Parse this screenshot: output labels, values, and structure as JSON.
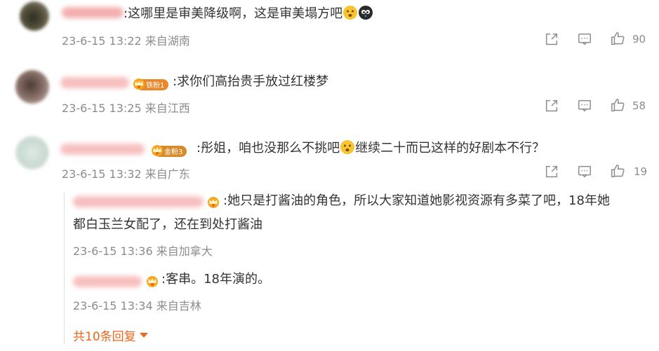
{
  "comments": [
    {
      "text": ":这哪里是审美降级啊，这是审美塌方吧",
      "time": "23-6-15 13:22",
      "location": "来自湖南",
      "likes": "90"
    },
    {
      "badge": "铁粉1",
      "text": ":求你们高抬贵手放过红楼梦",
      "time": "23-6-15 13:25",
      "location": "来自江西",
      "likes": "58"
    },
    {
      "badge": "金粉3",
      "text_a": ":彤姐，咱也没那么不挑吧",
      "text_b": "继续二十而已这样的好剧本不行？",
      "time": "23-6-15 13:32",
      "location": "来自广东",
      "likes": "19",
      "replies": [
        {
          "text_line1": ":她只是打酱油的角色，所以大家知道她影视资源有多菜了吧，18年她",
          "text_line2": "都白玉兰女配了，还在到处打酱油",
          "time": "23-6-15 13:36",
          "location": "来自加拿大"
        },
        {
          "text": ":客串。18年演的。",
          "time": "23-6-15 13:34",
          "location": "来自吉林"
        }
      ],
      "more_replies": "共10条回复"
    }
  ],
  "colors": {
    "meta": "#8c8c8c",
    "accent": "#e8671b",
    "text": "#333333"
  },
  "icons": [
    "share-icon",
    "comment-icon",
    "like-icon",
    "crown-badge-icon",
    "emoji-icon"
  ]
}
